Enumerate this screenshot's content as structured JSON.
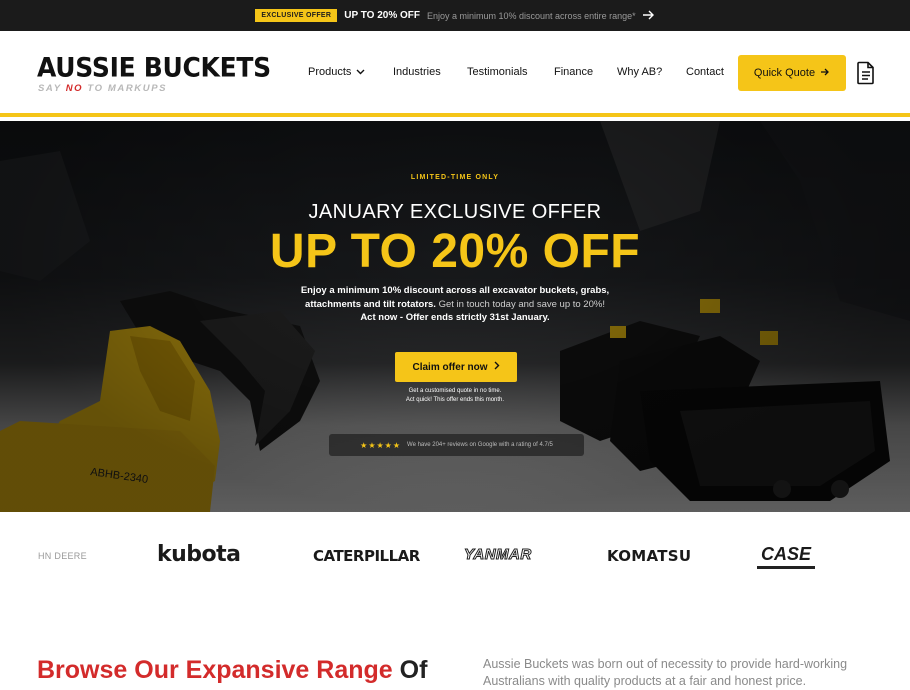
{
  "promo": {
    "badge": "EXCLUSIVE OFFER",
    "title": "UP TO 20% OFF",
    "text": "Enjoy a minimum 10% discount across entire range*",
    "arrow_icon": "arrow-right-icon"
  },
  "header": {
    "logo_title": "AUSSIE BUCKETS",
    "logo_tag_say": "SAY ",
    "logo_tag_no": "NO",
    "logo_tag_rest": " TO MARKUPS",
    "nav": [
      "Products",
      "Industries",
      "Testimonials",
      "Finance",
      "Why AB?",
      "Contact"
    ],
    "quote_label": "Quick Quote",
    "doc_icon": "document-icon"
  },
  "hero": {
    "kicker": "LIMITED-TIME ONLY",
    "subtitle": "JANUARY EXCLUSIVE OFFER",
    "title": "UP TO 20% OFF",
    "desc_line1": "Enjoy a minimum 10% discount across all excavator buckets, grabs,",
    "desc_line2a": "attachments and tilt rotators.",
    "desc_line2b": " Get in touch today and save up to 20%!",
    "desc_line3": "Act now - Offer ends strictly 31st January.",
    "claim_label": "Claim offer now",
    "note_line1": "Get a customised quote in no time.",
    "note_line2": "Act quick! This offer ends this month.",
    "stars": "★★★★★",
    "reviews_text": "We have 204+ reviews on Google with a rating of 4.7/5"
  },
  "brands": [
    "HN DEERE",
    "kubota",
    "CATERPILLAR",
    "YANMAR",
    "KOMATSU",
    "CASE"
  ],
  "browse": {
    "accent": "Browse Our Expansive Range",
    "rest": " Of"
  },
  "about": {
    "text": "Aussie Buckets was born out of necessity to provide hard-working Australians with quality products at a fair and honest price."
  },
  "colors": {
    "brand_yellow": "#f5c518",
    "accent_red": "#d32b2b",
    "dark": "#1b1b1b"
  }
}
